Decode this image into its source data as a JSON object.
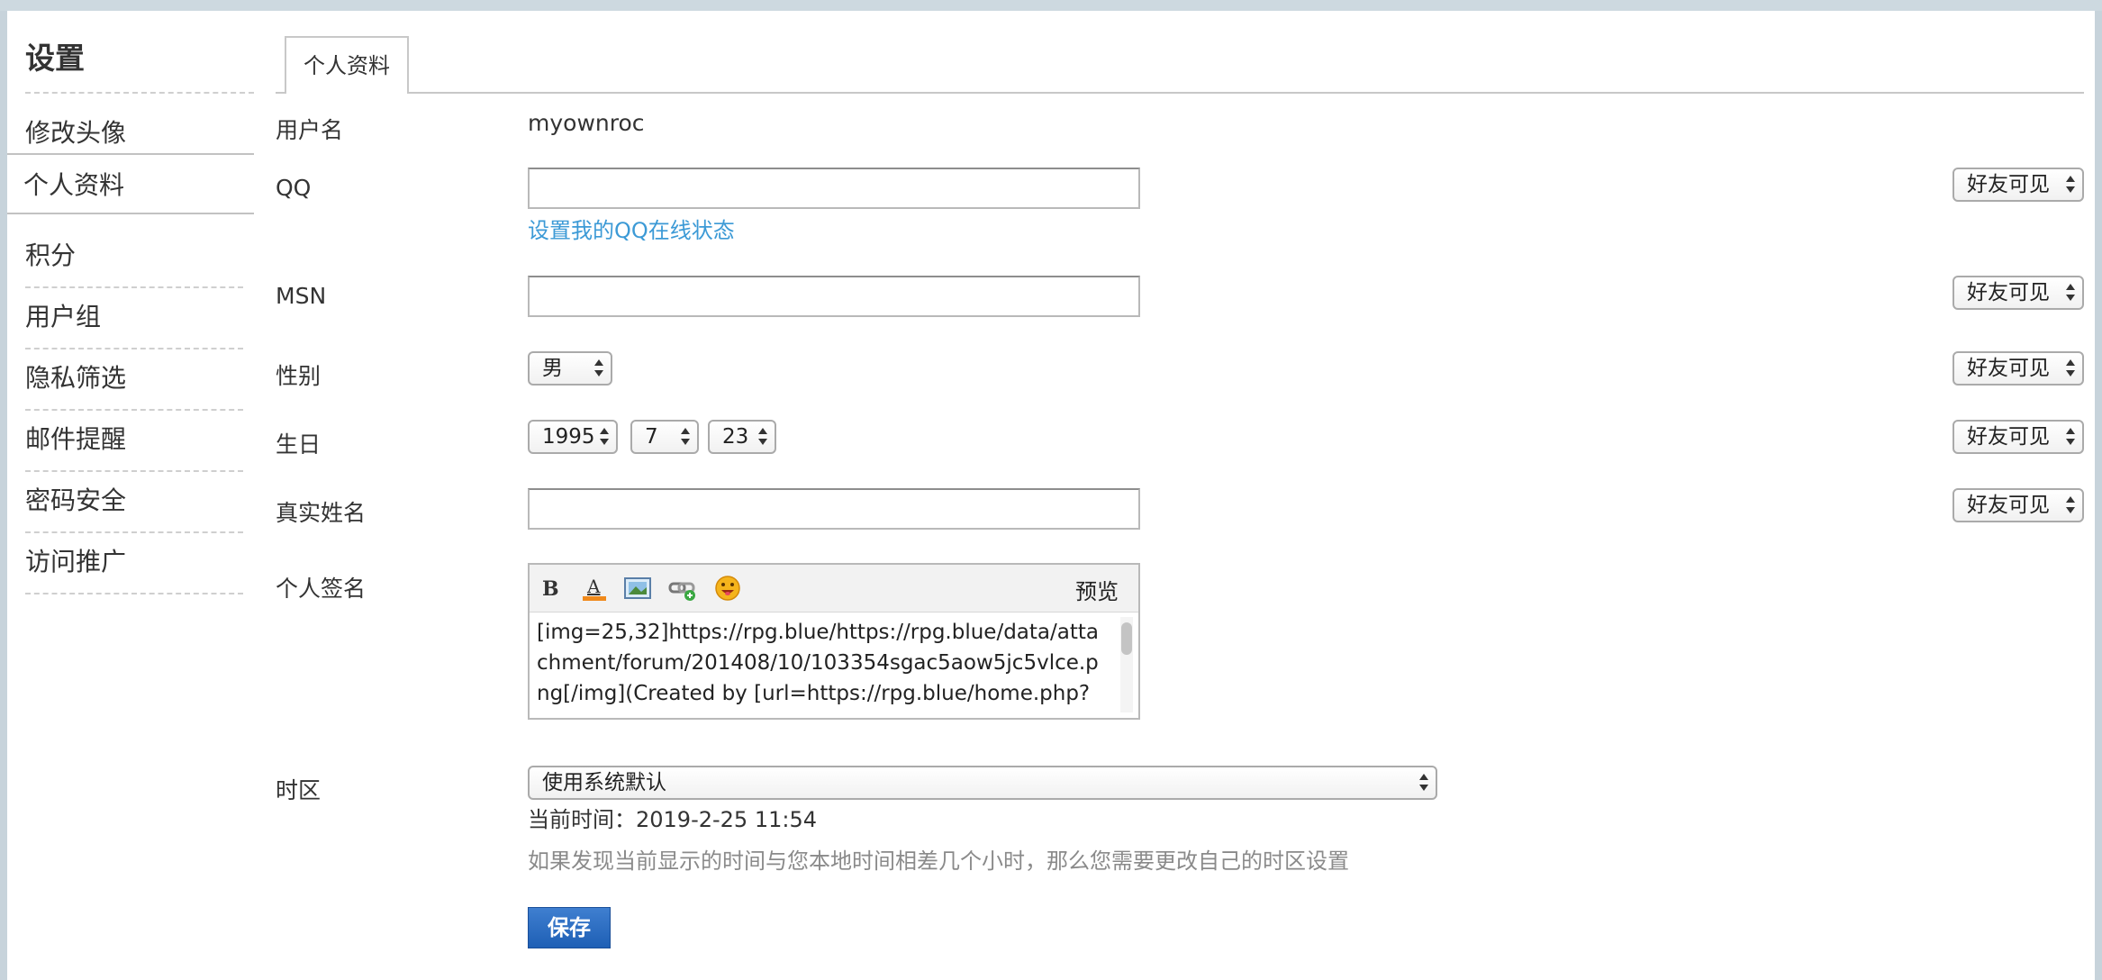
{
  "sidebar": {
    "title": "设置",
    "items": [
      {
        "label": "修改头像"
      },
      {
        "label": "个人资料"
      },
      {
        "label": "积分"
      },
      {
        "label": "用户组"
      },
      {
        "label": "隐私筛选"
      },
      {
        "label": "邮件提醒"
      },
      {
        "label": "密码安全"
      },
      {
        "label": "访问推广"
      }
    ]
  },
  "tab": {
    "label": "个人资料"
  },
  "form": {
    "username_label": "用户名",
    "username_value": "myownroc",
    "qq_label": "QQ",
    "qq_value": "",
    "qq_link": "设置我的QQ在线状态",
    "msn_label": "MSN",
    "msn_value": "",
    "gender_label": "性别",
    "gender_value": "男",
    "birthday_label": "生日",
    "birth_year": "1995",
    "birth_month": "7",
    "birth_day": "23",
    "realname_label": "真实姓名",
    "realname_value": "",
    "signature_label": "个人签名",
    "signature_preview": "预览",
    "signature_text": "[img=25,32]https://rpg.blue/https://rpg.blue/data/attachment/forum/201408/10/103354sgac5aow5jc5vlce.png[/img](Created by [url=https://rpg.blue/home.php?",
    "timezone_label": "时区",
    "timezone_value": "使用系统默认",
    "current_time": "当前时间：2019-2-25 11:54",
    "timezone_hint": "如果发现当前显示的时间与您本地时间相差几个小时，那么您需要更改自己的时区设置",
    "save_label": "保存"
  },
  "privacy": {
    "qq": "好友可见",
    "msn": "好友可见",
    "gender": "好友可见",
    "birthday": "好友可见",
    "realname": "好友可见"
  },
  "icons": {
    "bold": "bold-icon",
    "color": "font-color-icon",
    "image": "image-icon",
    "link": "link-icon",
    "emoji": "emoji-icon"
  },
  "colors": {
    "link": "#3c9ad6",
    "save_button": "#2a6cc4"
  }
}
